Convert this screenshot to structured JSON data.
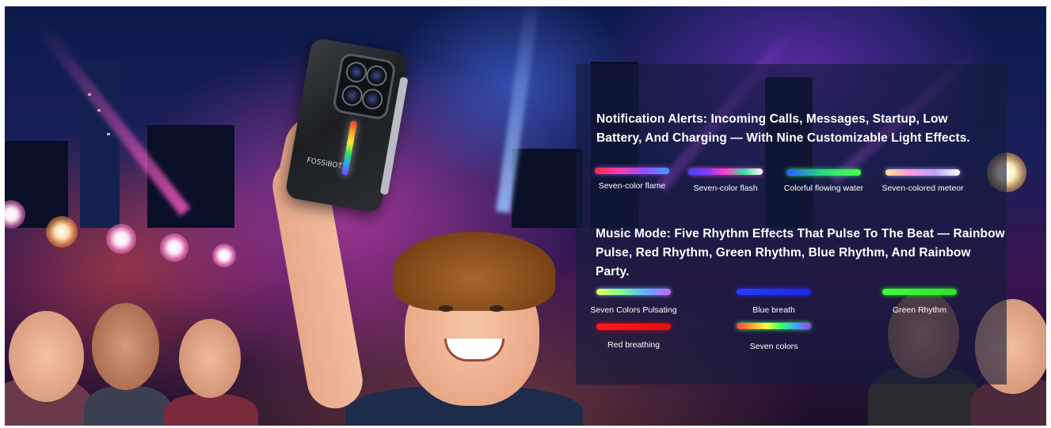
{
  "notification": {
    "heading_line1": "Notification Alerts: Incoming Calls, Messages, Startup, Low",
    "heading_line2": "Battery, And Charging — With Nine Customizable Light Effects.",
    "effects": [
      {
        "label": "Seven-color flame",
        "gradient": [
          "#ff2a3a",
          "#ff3fa8",
          "#9b4bff",
          "#3aa0ff"
        ]
      },
      {
        "label": "Seven-color flash",
        "gradient": [
          "#3a4bff",
          "#7a3bff",
          "#ff3fc8",
          "#39e0a0",
          "#ffffff"
        ]
      },
      {
        "label": "Colorful flowing water",
        "gradient": [
          "#2a5bff",
          "#2adf7a",
          "#4aff4a"
        ]
      },
      {
        "label": "Seven-colored meteor",
        "gradient": [
          "#ffe38a",
          "#ff9ae0",
          "#b9a4ff",
          "#ffffff"
        ]
      }
    ]
  },
  "music": {
    "heading_line1": "Music Mode: Five Rhythm Effects That Pulse To The Beat — Rainbow",
    "heading_line2": "Pulse, Red Rhythm, Green Rhythm, Blue Rhythm, And Rainbow Party.",
    "effects": [
      {
        "label": "Seven Colors Pulsating",
        "gradient": [
          "#fff25a",
          "#7dff8a",
          "#5ab0ff",
          "#d65aff"
        ]
      },
      {
        "label": "Blue breath",
        "gradient": [
          "#2a3bff",
          "#1a28e0"
        ]
      },
      {
        "label": "Green Rhythm",
        "gradient": [
          "#3cff3c",
          "#2ae02a"
        ]
      },
      {
        "label": "Red breathing",
        "gradient": [
          "#ff1a1a",
          "#e60e0e"
        ]
      },
      {
        "label": "Seven colors",
        "gradient": [
          "#ff3a3a",
          "#ffa13a",
          "#ffff3a",
          "#3aff6a",
          "#3aa8ff",
          "#b03aff"
        ]
      }
    ]
  },
  "phone": {
    "brand": "FOSSiBOT"
  },
  "colors": {
    "panel_bg": "#141c3c",
    "heading_text": "#ffffff"
  }
}
